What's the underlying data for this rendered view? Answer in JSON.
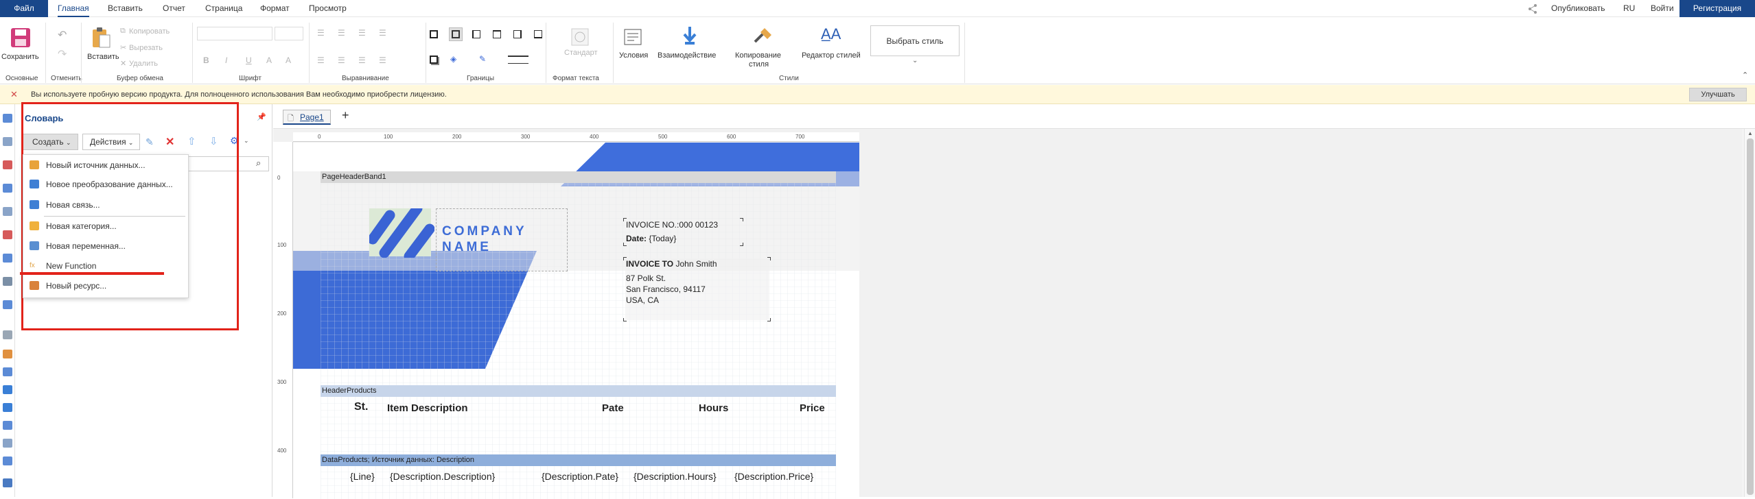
{
  "topbar": {
    "file": "Файл",
    "tabs": [
      "Главная",
      "Вставить",
      "Отчет",
      "Страница",
      "Формат",
      "Просмотр"
    ],
    "published": "Опубликовать",
    "lang": "RU",
    "login": "Войти",
    "register": "Регистрация"
  },
  "ribbon": {
    "save": "Сохранить",
    "paste": "Вставить",
    "copy": "Копировать",
    "cut": "Вырезать",
    "delete": "Удалить",
    "standard": "Стандарт",
    "conditions": "Условия",
    "interaction": "Взаимодействие",
    "copy_style": "Копирование стиля",
    "copy_style_1": "Копирование",
    "copy_style_2": "стиля",
    "style_editor": "Редактор стилей",
    "choose_style": "Выбрать стиль",
    "groups": {
      "main": "Основные",
      "undo": "Отменить",
      "clipboard": "Буфер обмена",
      "font": "Шрифт",
      "align": "Выравнивание",
      "borders": "Границы",
      "text_format": "Формат текста",
      "styles": "Стили"
    }
  },
  "notice": {
    "text": "Вы используете пробную версию продукта. Для полноценного использования Вам необходимо приобрести лицензию.",
    "upgrade": "Улучшать"
  },
  "dictionary": {
    "title": "Словарь",
    "create": "Создать",
    "actions": "Действия",
    "menu": [
      {
        "label": "Новый источник данных...",
        "color": "#e8a33a"
      },
      {
        "label": "Новое преобразование данных...",
        "color": "#3f7fd4"
      },
      {
        "label": "Новая связь...",
        "color": "#3f7fd4"
      },
      {
        "label": "Новая категория...",
        "color": "#f0b13c"
      },
      {
        "label": "Новая переменная...",
        "color": "#5a8fd1"
      },
      {
        "label": "New Function",
        "color": "#e0a44a"
      },
      {
        "label": "Новый ресурс...",
        "color": "#d9823b"
      }
    ]
  },
  "designer": {
    "page_tab": "Page1",
    "ruler_h": [
      "0",
      "100",
      "200",
      "300",
      "400",
      "500",
      "600",
      "700"
    ],
    "ruler_v": [
      "0",
      "100",
      "200",
      "300",
      "400"
    ],
    "bands": {
      "page_header": "PageHeaderBand1",
      "header_products": "HeaderProducts",
      "data_products": "DataProducts; Источник данных: Description"
    },
    "company": {
      "line1": "COMPANY",
      "line2": "NAME"
    },
    "invoice_no": "INVOICE NO.:000 00123",
    "date_label": "Date:",
    "date_value": "{Today}",
    "invoice_to_label": "INVOICE TO",
    "invoice_to_name": "John Smith",
    "address": [
      "87 Polk St.",
      "San Francisco, 94117",
      "USA, CA"
    ],
    "headers": [
      "St.",
      "Item Description",
      "Pate",
      "Hours",
      "Price"
    ],
    "data_fields": [
      "{Line}",
      "{Description.Description}",
      "{Description.Pate}",
      "{Description.Hours}",
      "{Description.Price}"
    ]
  },
  "colors": {
    "brand": "#19478a",
    "accent": "#3a68d8",
    "red_highlight": "#e2231a",
    "notice_bg": "#fff8dc"
  }
}
